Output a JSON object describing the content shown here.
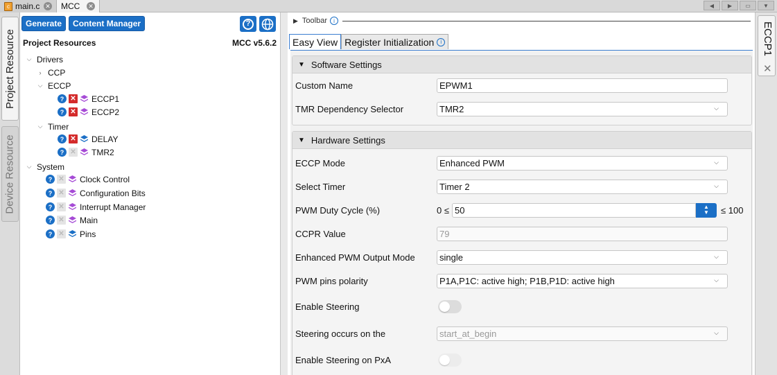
{
  "tabs": [
    {
      "label": "main.c",
      "icon": "c-file-icon"
    },
    {
      "label": "MCC"
    }
  ],
  "side_tabs": {
    "project_resource": "Project Resource",
    "device_resource": "Device Resource"
  },
  "left": {
    "generate_label": "Generate",
    "content_manager_label": "Content Manager",
    "header": "Project Resources",
    "version": "MCC v5.6.2",
    "tree": {
      "drivers": "Drivers",
      "ccp": "CCP",
      "eccp": "ECCP",
      "eccp1": "ECCP1",
      "eccp2": "ECCP2",
      "timer": "Timer",
      "delay": "DELAY",
      "tmr2": "TMR2",
      "system": "System",
      "clock_control": "Clock Control",
      "configuration_bits": "Configuration Bits",
      "interrupt_manager": "Interrupt Manager",
      "main": "Main",
      "pins": "Pins"
    }
  },
  "main": {
    "toolbar_label": "Toolbar",
    "view_tabs": {
      "easy_view": "Easy View",
      "register_init": "Register Initialization"
    },
    "software": {
      "title": "Software Settings",
      "custom_name_label": "Custom Name",
      "custom_name_value": "EPWM1",
      "tmr_dep_label": "TMR Dependency Selector",
      "tmr_dep_value": "TMR2"
    },
    "hardware": {
      "title": "Hardware Settings",
      "eccp_mode_label": "ECCP Mode",
      "eccp_mode_value": "Enhanced PWM",
      "select_timer_label": "Select Timer",
      "select_timer_value": "Timer 2",
      "pwm_duty_label": "PWM Duty Cycle (%)",
      "pwm_duty_min": "0 ≤",
      "pwm_duty_value": "50",
      "pwm_duty_max": "≤ 100",
      "ccpr_label": "CCPR Value",
      "ccpr_value": "79",
      "epwm_output_label": "Enhanced PWM Output Mode",
      "epwm_output_value": "single",
      "polarity_label": "PWM pins polarity",
      "polarity_value": "P1A,P1C: active high; P1B,P1D: active high",
      "enable_steering_label": "Enable Steering",
      "steering_occurs_label": "Steering occurs on the",
      "steering_occurs_value": "start_at_begin",
      "steering_pxa_label": "Enable Steering on PxA"
    }
  },
  "right_tab": {
    "label": "ECCP1"
  },
  "colors": {
    "accent": "#1b6fc6",
    "remove": "#d42b2b",
    "module_purple": "#a64bd6",
    "module_blue": "#1b6fc6"
  }
}
